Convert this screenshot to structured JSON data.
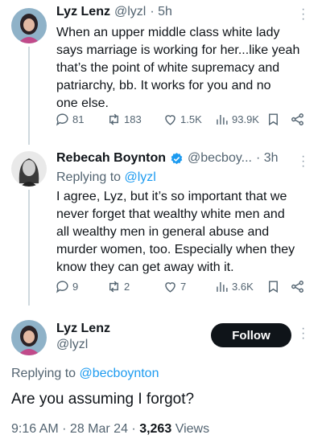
{
  "tweets": [
    {
      "author": "Lyz Lenz",
      "handle": "@lyzl",
      "time": "· 5h",
      "text_lines": [
        "When an upper middle class white lady",
        "says marriage is working for her...like yeah",
        "that’s the point of white supremacy and",
        "patriarchy, bb. It works for you and no",
        "one else."
      ],
      "replies": "81",
      "retweets": "183",
      "likes": "1.5K",
      "views": "93.9K"
    },
    {
      "author": "Rebecah Boynton",
      "handle": "@becboy...",
      "time": "· 3h",
      "replying_label": "Replying to",
      "replying_to": "@lyzl",
      "text_lines": [
        "I agree, Lyz, but it’s so important that we",
        "never forget that wealthy white men and",
        "all wealthy men in general abuse and",
        "murder women, too. Especially when they",
        "know they can get away with it."
      ],
      "replies": "9",
      "retweets": "2",
      "likes": "7",
      "views": "3.6K"
    }
  ],
  "main_tweet": {
    "author": "Lyz Lenz",
    "handle": "@lyzl",
    "follow_label": "Follow",
    "replying_label": "Replying to",
    "replying_to": "@becboynton",
    "text": "Are you assuming I forgot?",
    "timestamp": "9:16 AM · 28 Mar 24 ·",
    "views_count": "3,263",
    "views_label": "Views"
  },
  "colors": {
    "accent": "#1d9bf0",
    "muted": "#536471",
    "text": "#0f1419",
    "verified": "#1d9bf0"
  }
}
